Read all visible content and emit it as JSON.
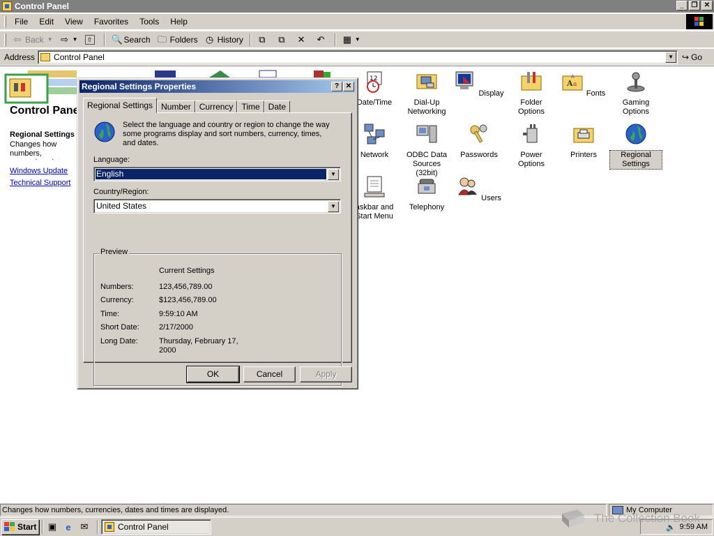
{
  "window": {
    "title": "Control Panel"
  },
  "menu": [
    "File",
    "Edit",
    "View",
    "Favorites",
    "Tools",
    "Help"
  ],
  "toolbar": {
    "back": "Back",
    "search": "Search",
    "folders": "Folders",
    "history": "History"
  },
  "address": {
    "label": "Address",
    "value": "Control Panel",
    "go": "Go"
  },
  "left_panel": {
    "title": "Control Panel",
    "selected_title": "Regional Settings",
    "selected_desc": "Changes how numbers, currencies, dates and times are displayed.",
    "links": [
      "Windows Update",
      "Technical Support"
    ]
  },
  "icons": [
    {
      "label": "Date/Time"
    },
    {
      "label": "Dial-Up Networking"
    },
    {
      "label": "Display"
    },
    {
      "label": "Folder Options"
    },
    {
      "label": "Fonts"
    },
    {
      "label": "Gaming Options"
    },
    {
      "label": "Network"
    },
    {
      "label": "ODBC Data Sources (32bit)"
    },
    {
      "label": "Passwords"
    },
    {
      "label": "Power Options"
    },
    {
      "label": "Printers"
    },
    {
      "label": "Regional Settings"
    },
    {
      "label": "askbar and Start Menu"
    },
    {
      "label": "Telephony"
    },
    {
      "label": "Users"
    }
  ],
  "dialog": {
    "title": "Regional Settings Properties",
    "help_btn": "?",
    "close_btn": "✕",
    "tabs": [
      "Regional Settings",
      "Number",
      "Currency",
      "Time",
      "Date"
    ],
    "description": "Select the language and country or region to change the way some programs display and sort numbers, currency, times, and dates.",
    "language_label": "Language:",
    "language_value": "English",
    "country_label": "Country/Region:",
    "country_value": "United States",
    "preview_legend": "Preview",
    "current_settings": "Current Settings",
    "preview": [
      {
        "label": "Numbers:",
        "value": "123,456,789.00"
      },
      {
        "label": "Currency:",
        "value": "$123,456,789.00"
      },
      {
        "label": "Time:",
        "value": "9:59:10 AM"
      },
      {
        "label": "Short Date:",
        "value": "2/17/2000"
      },
      {
        "label": "Long Date:",
        "value": "Thursday, February 17, 2000"
      }
    ],
    "ok": "OK",
    "cancel": "Cancel",
    "apply": "Apply"
  },
  "status": {
    "text": "Changes how numbers, currencies, dates and times are displayed.",
    "zone": "My Computer"
  },
  "taskbar": {
    "start": "Start",
    "task": "Control Panel",
    "clock": "9:59 AM"
  },
  "watermark": "The Collection Book",
  "colors": {
    "title_active_start": "#0a246a",
    "title_active_end": "#a6caf0",
    "face": "#d4d0c8",
    "link": "#0000cc"
  }
}
